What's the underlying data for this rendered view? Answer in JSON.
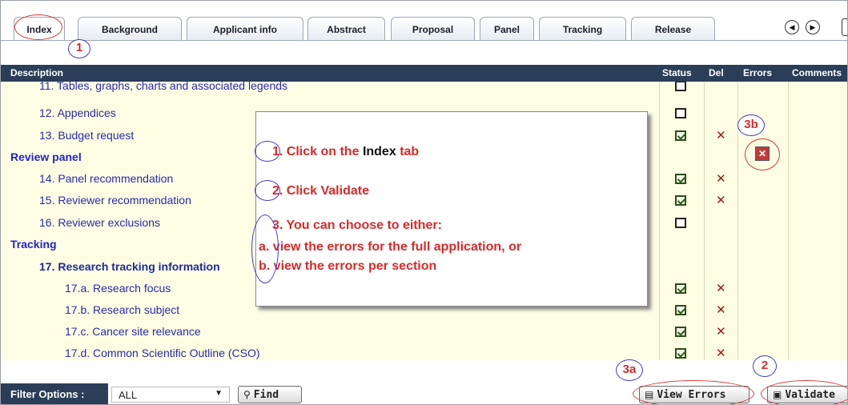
{
  "tabs": [
    "Index",
    "Background",
    "Applicant info",
    "Abstract",
    "Proposal",
    "Panel",
    "Tracking",
    "Release"
  ],
  "nav": {
    "prev_icon": "circle-arrow-left-icon",
    "next_icon": "circle-arrow-right-icon"
  },
  "columns": {
    "description": "Description",
    "status": "Status",
    "del": "Del",
    "errors": "Errors",
    "comments": "Comments"
  },
  "rows": [
    {
      "label": "11. Tables, graphs, charts and associated legends",
      "status": "unchecked",
      "del": false
    },
    {
      "label": "12. Appendices",
      "status": "unchecked",
      "del": false
    },
    {
      "label": "13. Budget request",
      "status": "checked",
      "del": true
    },
    {
      "label": "Review panel",
      "section": true
    },
    {
      "label": "14. Panel recommendation",
      "status": "checked",
      "del": true
    },
    {
      "label": "15. Reviewer recommendation",
      "status": "checked",
      "del": true
    },
    {
      "label": "16. Reviewer exclusions",
      "status": "unchecked",
      "del": false
    },
    {
      "label": "Tracking",
      "section": true
    },
    {
      "label": "17. Research tracking information",
      "bold": true
    },
    {
      "label": "17.a. Research focus",
      "status": "checked",
      "del": true,
      "sub": true
    },
    {
      "label": "17.b. Research subject",
      "status": "checked",
      "del": true,
      "sub": true
    },
    {
      "label": "17.c. Cancer site relevance",
      "status": "checked",
      "del": true,
      "sub": true
    },
    {
      "label": "17.d. Common Scientific Outline (CSO)",
      "status": "checked",
      "del": true,
      "sub": true
    }
  ],
  "callout": {
    "step1_num": "1.",
    "step1_a": "Click on the",
    "step1_b": "Index",
    "step1_c": "tab",
    "step2_num": "2.",
    "step2": "Click Validate",
    "step3_num": "3.",
    "step3": "You can choose to either:",
    "step3a": "a. view the errors for the full application, or",
    "step3b": "b. view the errors per section"
  },
  "markers": {
    "m1": "1",
    "m2": "2",
    "m3a": "3a",
    "m3b": "3b"
  },
  "footer": {
    "filter_label": "Filter Options :",
    "filter_value": "ALL",
    "find_label": "Find",
    "view_errors_label": "View Errors",
    "validate_label": "Validate"
  },
  "colors": {
    "header_bg": "#2b3e58",
    "grid_bg": "#fdfde3",
    "link": "#2a2ab0",
    "annotation_red": "#d92a2a",
    "annotation_blue": "#3c3cd0"
  }
}
